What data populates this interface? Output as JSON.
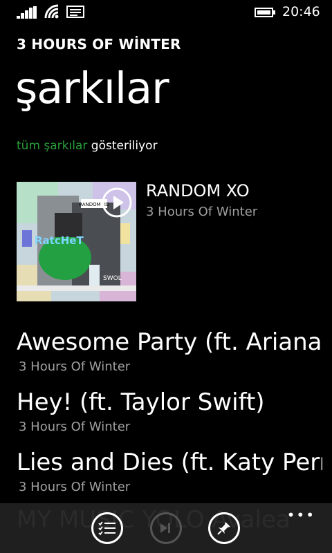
{
  "status": {
    "time": "20:46"
  },
  "header": {
    "app_title": "3 HOURS OF WİNTER",
    "page_title": "şarkılar",
    "filter_accent": "tüm şarkılar",
    "filter_rest": " gösteriliyor"
  },
  "album": {
    "title": "RANDOM XO",
    "artist": "3 Hours Of Winter",
    "art_labels": {
      "top": "RANDOM XO",
      "main": "RatcHeT",
      "bottom": "SWOL"
    }
  },
  "songs": [
    {
      "title": "Awesome Party (ft. Ariana Grande)",
      "artist": "3 Hours Of Winter"
    },
    {
      "title": "Hey! (ft. Taylor Swift)",
      "artist": "3 Hours Of Winter"
    },
    {
      "title": "Lies and Dies (ft. Katy Perry)",
      "artist": "3 Hours Of Winter"
    }
  ],
  "appbar": {
    "ghost_text": "MY MUSIC YOLO Avalea",
    "buttons": [
      "list-icon",
      "play-next-icon",
      "pin-icon"
    ],
    "more_label": "•••"
  },
  "colors": {
    "accent": "#2a9d3a",
    "background": "#000000",
    "secondary_text": "#a0a0a0",
    "appbar": "#1f1f1f"
  }
}
